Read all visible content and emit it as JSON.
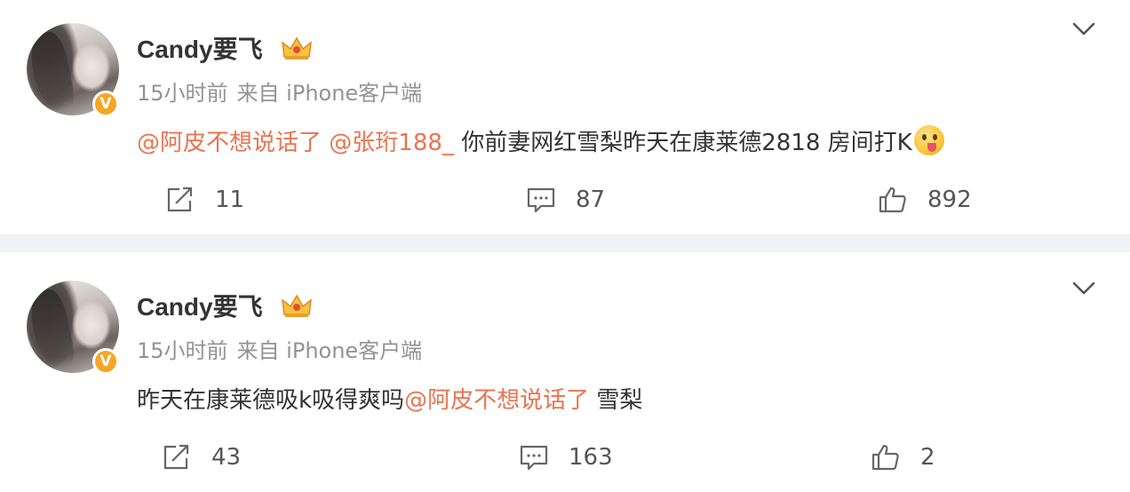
{
  "posts": [
    {
      "username": "Candy要飞",
      "time": "15小时前",
      "source": "来自 iPhone客户端",
      "mention1": "@阿皮不想说话了",
      "mention2": "@张珩188_",
      "text_tail": "你前妻网红雪梨昨天在康莱德2818 房间打K",
      "reposts": "11",
      "comments": "87",
      "likes": "892"
    },
    {
      "username": "Candy要飞",
      "time": "15小时前",
      "source": "来自 iPhone客户端",
      "text_head": "昨天在康莱德吸k吸得爽吗",
      "mention1": "@阿皮不想说话了",
      "text_tail": "雪梨",
      "reposts": "43",
      "comments": "163",
      "likes": "2"
    }
  ],
  "badge": {
    "verified_symbol": "V"
  },
  "colors": {
    "mention": "#eb7350",
    "meta": "#939393",
    "divider": "#f1f2f5",
    "badge": "#f5a623"
  },
  "icons": [
    "chevron-down-icon",
    "crown-icon",
    "repost-icon",
    "comment-icon",
    "like-icon",
    "emoji-icon"
  ]
}
